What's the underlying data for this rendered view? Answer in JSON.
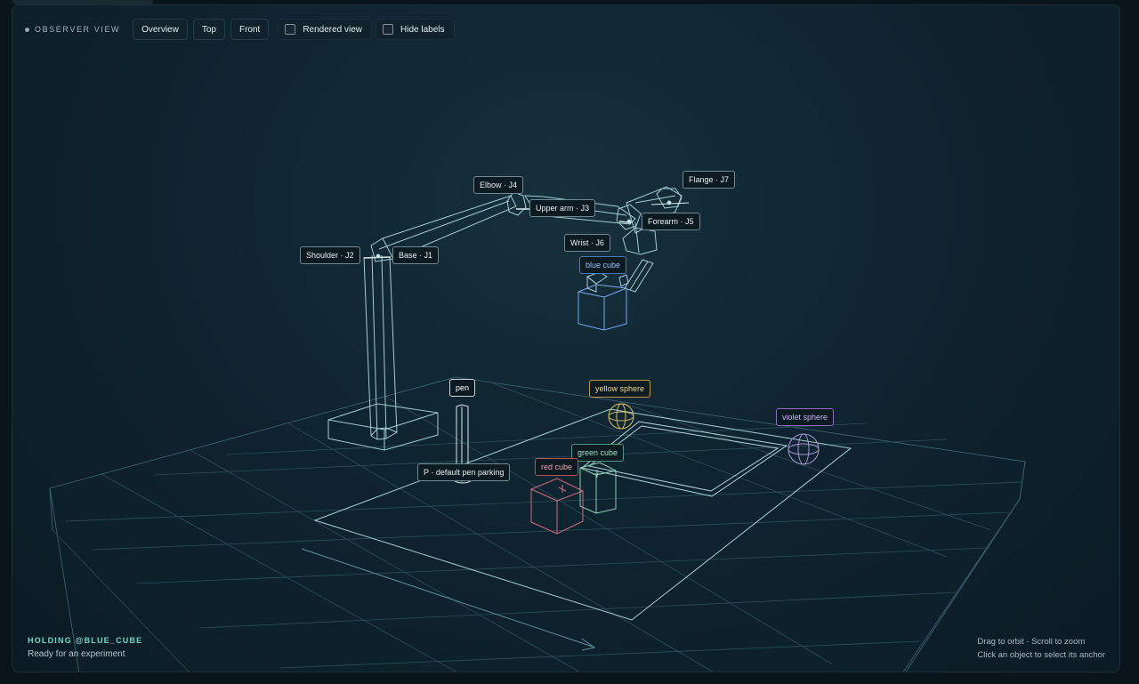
{
  "toolbar": {
    "title": "OBSERVER VIEW",
    "views": [
      "Overview",
      "Top",
      "Front"
    ],
    "rendered_view_label": "Rendered view",
    "rendered_view_checked": false,
    "hide_labels_label": "Hide labels",
    "hide_labels_checked": false
  },
  "joints": {
    "base": "Base · J1",
    "shoulder": "Shoulder · J2",
    "upper_arm": "Upper arm · J3",
    "elbow": "Elbow · J4",
    "forearm": "Forearm · J5",
    "wrist": "Wrist · J6",
    "flange": "Flange · J7"
  },
  "objects": {
    "blue_cube": "blue cube",
    "yellow_sphere": "yellow sphere",
    "violet_sphere": "violet sphere",
    "green_cube": "green cube",
    "red_cube": "red cube",
    "pen": "pen",
    "pen_parking": "P · default pen parking"
  },
  "colors": {
    "wire": "#8fc7cf",
    "grid": "#2f5560",
    "blue": "#7aa7ea",
    "yellow": "#d8bb66",
    "violet": "#a893d6",
    "green": "#8fd0b8",
    "red": "#d26b7e"
  },
  "status": {
    "holding": "HOLDING @BLUE_CUBE",
    "message": "Ready for an experiment"
  },
  "hints": {
    "line1": "Drag to orbit · Scroll to zoom",
    "line2": "Click an object to select its anchor"
  }
}
